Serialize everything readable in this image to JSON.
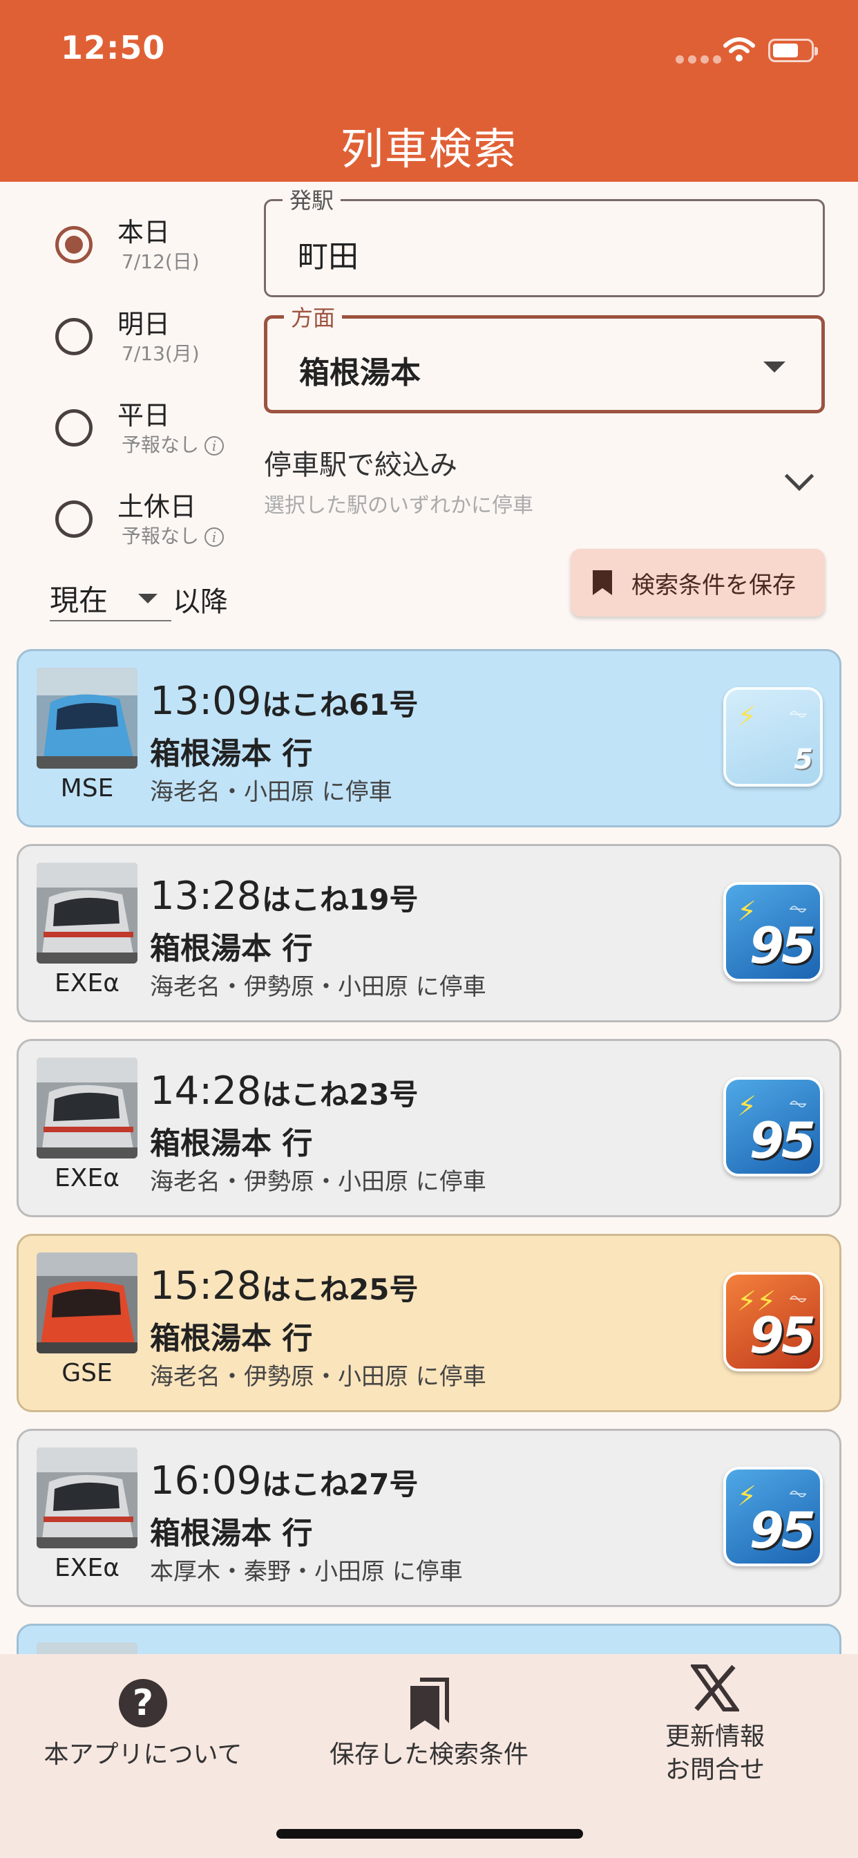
{
  "status_bar": {
    "time": "12:50"
  },
  "header": {
    "title": "列車検索"
  },
  "date_options": [
    {
      "label": "本日",
      "sub": "7/12(日)",
      "selected": true
    },
    {
      "label": "明日",
      "sub": "7/13(月)",
      "selected": false
    },
    {
      "label": "平日",
      "sub": "予報なし",
      "selected": false
    },
    {
      "label": "土休日",
      "sub": "予報なし",
      "selected": false
    }
  ],
  "time_filter": {
    "value": "現在",
    "suffix": "以降"
  },
  "departure": {
    "label": "発駅",
    "value": "町田"
  },
  "direction": {
    "label": "方面",
    "value": "箱根湯本"
  },
  "stop_filter": {
    "title": "停車駅で絞込み",
    "subtitle": "選択した駅のいずれかに停車"
  },
  "save_button": {
    "label": "検索条件を保存"
  },
  "trains": [
    {
      "code": "MSE",
      "time": "13:09",
      "name": "はこね61号",
      "destination": "箱根湯本 行",
      "stops": "海老名・小田原 に停車",
      "badge": "5",
      "theme": "mse"
    },
    {
      "code": "EXEα",
      "time": "13:28",
      "name": "はこね19号",
      "destination": "箱根湯本 行",
      "stops": "海老名・伊勢原・小田原 に停車",
      "badge": "95",
      "theme": "exe"
    },
    {
      "code": "EXEα",
      "time": "14:28",
      "name": "はこね23号",
      "destination": "箱根湯本 行",
      "stops": "海老名・伊勢原・小田原 に停車",
      "badge": "95",
      "theme": "exe"
    },
    {
      "code": "GSE",
      "time": "15:28",
      "name": "はこね25号",
      "destination": "箱根湯本 行",
      "stops": "海老名・伊勢原・小田原 に停車",
      "badge": "95",
      "theme": "gse"
    },
    {
      "code": "EXEα",
      "time": "16:09",
      "name": "はこね27号",
      "destination": "箱根湯本 行",
      "stops": "本厚木・秦野・小田原 に停車",
      "badge": "95",
      "theme": "exe"
    }
  ],
  "bottom_nav": {
    "about": "本アプリについて",
    "saved": "保存した検索条件",
    "news_line1": "更新情報",
    "news_line2": "お問合せ"
  },
  "colors": {
    "header": "#e06036",
    "accent": "#9c5340",
    "mse_card": "#c0e3f8",
    "gse_card": "#fae4bc"
  }
}
